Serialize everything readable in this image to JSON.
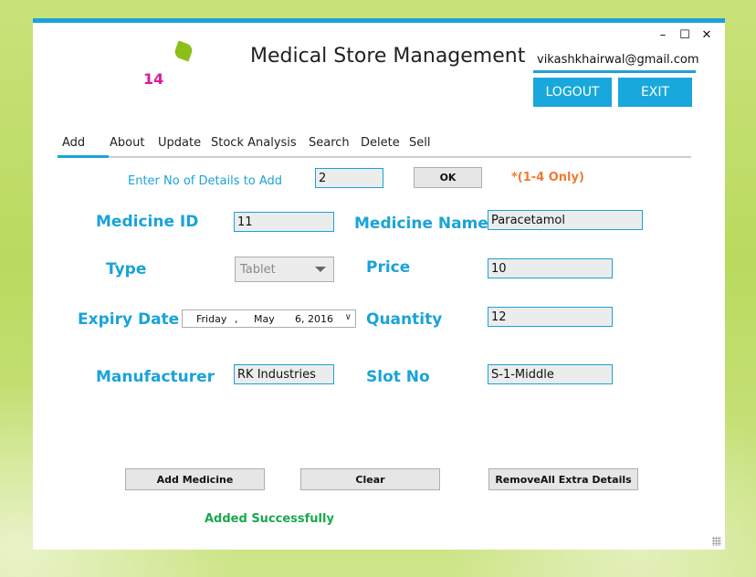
{
  "app": {
    "title": "Medical Store Management",
    "counter": "14",
    "user_email": "vikashkhairwal@gmail.com",
    "logout_label": "LOGOUT",
    "exit_label": "EXIT",
    "minimize_glyph": "–",
    "maximize_glyph": "☐",
    "close_glyph": "✕"
  },
  "tabs": [
    {
      "label": "Add",
      "active": true
    },
    {
      "label": "About"
    },
    {
      "label": "Update"
    },
    {
      "label": "Stock Analysis"
    },
    {
      "label": "Search"
    },
    {
      "label": "Delete"
    },
    {
      "label": "Sell"
    }
  ],
  "details_count": {
    "label": "Enter No of Details  to Add",
    "value": "2",
    "ok_label": "OK",
    "note": "*(1-4 Only)"
  },
  "form": {
    "medicine_id": {
      "label": "Medicine ID",
      "value": "11"
    },
    "medicine_name": {
      "label": "Medicine Name",
      "value": "Paracetamol"
    },
    "type": {
      "label": "Type",
      "value": "Tablet"
    },
    "price": {
      "label": "Price",
      "value": "10"
    },
    "expiry_date": {
      "label": "Expiry Date",
      "day_name": "Friday",
      "sep": ",",
      "month": "May",
      "day_year": "6, 2016"
    },
    "quantity": {
      "label": "Quantity",
      "value": "12"
    },
    "manufacturer": {
      "label": "Manufacturer",
      "value": "RK Industries"
    },
    "slot_no": {
      "label": "Slot No",
      "value": "S-1-Middle"
    }
  },
  "actions": {
    "add_label": "Add Medicine",
    "clear_label": "Clear",
    "remove_label": "RemoveAll Extra Details"
  },
  "status": "Added Successfully",
  "colors": {
    "accent": "#1aa3d8",
    "counter": "#e0179c",
    "note": "#f07a33",
    "success": "#1aa84e",
    "logo": "#8cbf1a"
  }
}
